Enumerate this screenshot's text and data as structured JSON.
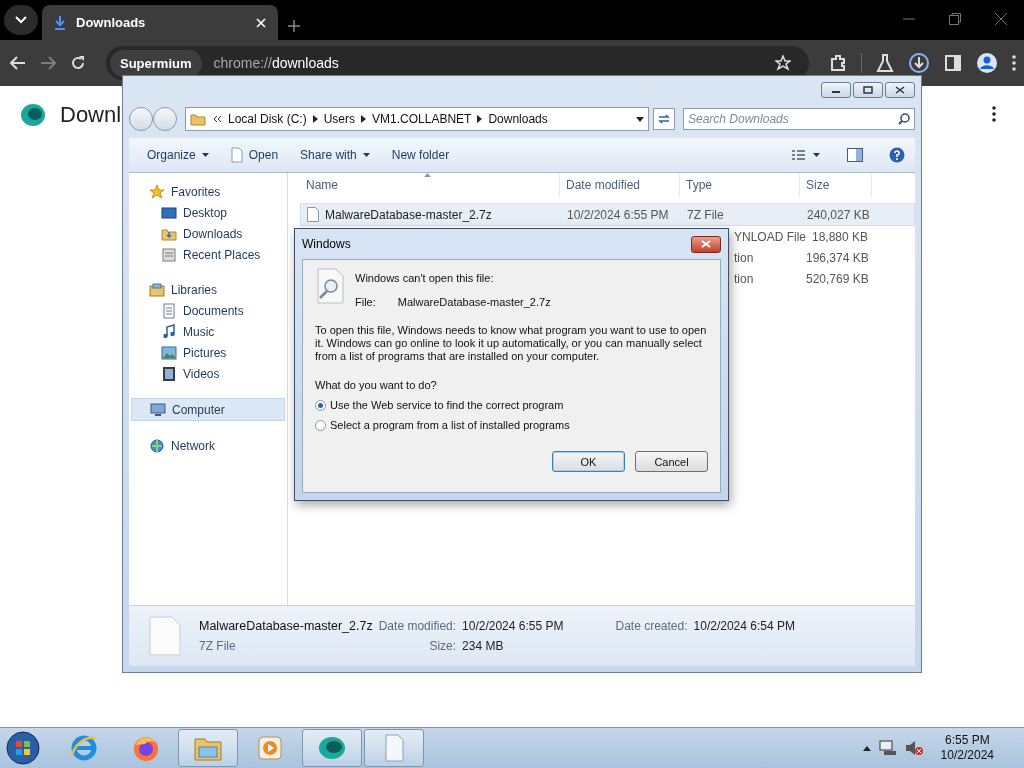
{
  "browser": {
    "tab": {
      "title": "Downloads"
    },
    "omnibox": {
      "chip": "Supermium",
      "scheme": "chrome://",
      "path": "downloads"
    },
    "back_disabled": false,
    "forward_disabled": true
  },
  "page": {
    "title": "Downl"
  },
  "explorer": {
    "breadcrumb": [
      "Local Disk (C:)",
      "Users",
      "VM1.COLLABNET",
      "Downloads"
    ],
    "search": {
      "placeholder": "Search Downloads"
    },
    "toolbar": [
      {
        "label": "Organize",
        "dropdown": true,
        "icon": false
      },
      {
        "label": "Open",
        "dropdown": false,
        "icon": true
      },
      {
        "label": "Share with",
        "dropdown": true,
        "icon": false
      },
      {
        "label": "New folder",
        "dropdown": false,
        "icon": false
      }
    ],
    "nav": [
      {
        "label": "Favorites",
        "kind": "favorites",
        "selected": false,
        "children": [
          {
            "label": "Desktop",
            "kind": "desktop",
            "selected": false
          },
          {
            "label": "Downloads",
            "kind": "downloads",
            "selected": false
          },
          {
            "label": "Recent Places",
            "kind": "recent",
            "selected": false
          }
        ]
      },
      {
        "label": "Libraries",
        "kind": "libraries",
        "selected": false,
        "children": [
          {
            "label": "Documents",
            "kind": "documents",
            "selected": false
          },
          {
            "label": "Music",
            "kind": "music",
            "selected": false
          },
          {
            "label": "Pictures",
            "kind": "pictures",
            "selected": false
          },
          {
            "label": "Videos",
            "kind": "videos",
            "selected": false
          }
        ]
      },
      {
        "label": "Computer",
        "kind": "computer",
        "selected": true
      },
      {
        "label": "Network",
        "kind": "network",
        "selected": false
      }
    ],
    "columns": [
      "Name",
      "Date modified",
      "Type",
      "Size"
    ],
    "rows": [
      {
        "name": "MalwareDatabase-master_2.7z",
        "date": "10/2/2024 6:55 PM",
        "type": "7Z File",
        "size": "240,027 KB",
        "selected": true
      },
      {
        "type": "YNLOAD File",
        "size": "18,880 KB",
        "selected": false
      },
      {
        "type": "tion",
        "size": "196,374 KB",
        "selected": false
      },
      {
        "type": "tion",
        "size": "520,769 KB",
        "selected": false
      }
    ],
    "details": {
      "name": "MalwareDatabase-master_2.7z",
      "type": "7Z File",
      "modified_label": "Date modified:",
      "modified": "10/2/2024 6:55 PM",
      "size_label": "Size:",
      "size": "234 MB",
      "created_label": "Date created:",
      "created": "10/2/2024 6:54 PM"
    }
  },
  "dialog": {
    "title": "Windows",
    "heading": "Windows can't open this file:",
    "file_label": "File:",
    "file": "MalwareDatabase-master_2.7z",
    "body": "To open this file, Windows needs to know what program you want to use to open it. Windows can go online to look it up automatically, or you can manually select from a list of programs that are installed on your computer.",
    "question": "What do you want to do?",
    "options": [
      {
        "label": "Use the Web service to find the correct program",
        "selected": true
      },
      {
        "label": "Select a program from a list of installed programs",
        "selected": false
      }
    ],
    "buttons": [
      {
        "label": "OK",
        "default": true
      },
      {
        "label": "Cancel",
        "default": false
      }
    ]
  },
  "taskbar": {
    "items": [
      {
        "kind": "ie",
        "running": false
      },
      {
        "kind": "firefox",
        "running": false
      },
      {
        "kind": "explorer",
        "running": true
      },
      {
        "kind": "media",
        "running": false
      },
      {
        "kind": "app",
        "running": true
      },
      {
        "kind": "document",
        "running": true
      }
    ],
    "time": "6:55 PM",
    "date": "10/2/2024"
  }
}
